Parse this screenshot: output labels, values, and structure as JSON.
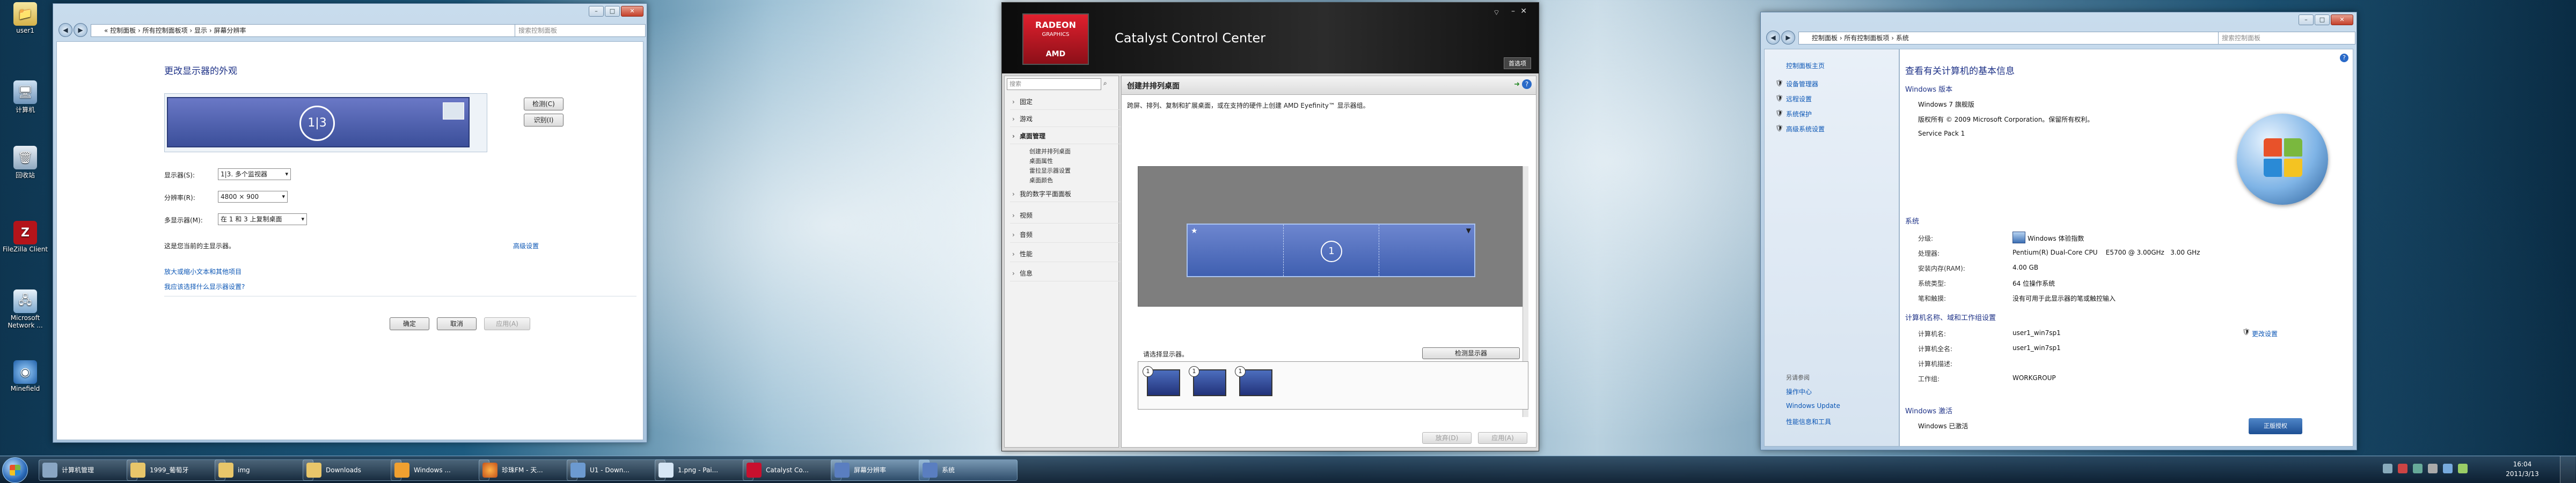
{
  "desktop": {
    "icons": [
      {
        "label": "user1"
      },
      {
        "label": "计算机"
      },
      {
        "label": "回收站"
      },
      {
        "label": "FileZilla Client"
      },
      {
        "label": "Microsoft Network ..."
      },
      {
        "label": "Minefield"
      }
    ]
  },
  "display_window": {
    "address": "« 控制面板 › 所有控制面板项 › 显示 › 屏幕分辨率",
    "search_placeholder": "搜索控制面板",
    "heading": "更改显示器的外观",
    "monitor_badge": "1|3",
    "detect_button": "检测(C)",
    "identify_button": "识别(I)",
    "display_label": "显示器(S):",
    "display_value": "1|3. 多个监视器",
    "resolution_label": "分辨率(R):",
    "resolution_value": "4800 × 900",
    "multi_label": "多显示器(M):",
    "multi_value": "在 1 和 3 上复制桌面",
    "main_display_text": "这是您当前的主显示器。",
    "advanced_link": "高级设置",
    "link_text_size": "放大或缩小文本和其他项目",
    "link_which_settings": "我应该选择什么显示器设置?",
    "ok_button": "确定",
    "cancel_button": "取消",
    "apply_button": "应用(A)"
  },
  "catalyst": {
    "title": "Catalyst Control Center",
    "logo_brand": "RADEON",
    "logo_sub": "GRAPHICS",
    "logo_maker": "AMD",
    "welcome_label": "首选项",
    "search_placeholder": "搜索",
    "page_title": "创建并排列桌面",
    "description": "跨屏、排列、复制和扩展桌面，或在支持的硬件上创建 AMD Eyefinity™ 显示器组。",
    "menu": [
      {
        "label": "固定"
      },
      {
        "label": "游戏"
      },
      {
        "label": "桌面管理"
      },
      {
        "label": "我的数字平面面板"
      },
      {
        "label": "视频"
      },
      {
        "label": "音频"
      },
      {
        "label": "性能"
      },
      {
        "label": "信息"
      }
    ],
    "submenu": [
      {
        "label": "创建并排列桌面"
      },
      {
        "label": "桌面属性"
      },
      {
        "label": "雷拉显示器设置"
      },
      {
        "label": "桌面颜色"
      }
    ],
    "desktop_badge": "1",
    "select_display_text": "请选择显示器。",
    "detect_button": "检测显示器",
    "discard_button": "放弃(D)",
    "apply_button": "应用(A)",
    "monitors": [
      {
        "label": "1"
      },
      {
        "label": "1"
      },
      {
        "label": "1"
      }
    ]
  },
  "system_window": {
    "address": "控制面板 › 所有控制面板项 › 系统",
    "search_placeholder": "搜索控制面板",
    "left_links": [
      "控制面板主页",
      "设备管理器",
      "远程设置",
      "系统保护",
      "高级系统设置"
    ],
    "see_also_title": "另请参阅",
    "see_also": [
      "操作中心",
      "Windows Update",
      "性能信息和工具"
    ],
    "heading": "查看有关计算机的基本信息",
    "edition_title": "Windows 版本",
    "edition": "Windows 7 旗舰版",
    "copyright": "版权所有 © 2009 Microsoft Corporation。保留所有权利。",
    "service_pack": "Service Pack 1",
    "system_title": "系统",
    "system_rows": [
      {
        "label": "分级:",
        "value": "Windows 体验指数"
      },
      {
        "label": "处理器:",
        "value": "Pentium(R) Dual-Core CPU    E5700 @ 3.00GHz   3.00 GHz"
      },
      {
        "label": "安装内存(RAM):",
        "value": "4.00 GB"
      },
      {
        "label": "系统类型:",
        "value": "64 位操作系统"
      },
      {
        "label": "笔和触摸:",
        "value": "没有可用于此显示器的笔或触控输入"
      }
    ],
    "computer_title": "计算机名称、域和工作组设置",
    "computer_rows": [
      {
        "label": "计算机名:",
        "value": "user1_win7sp1"
      },
      {
        "label": "计算机全名:",
        "value": "user1_win7sp1"
      },
      {
        "label": "计算机描述:",
        "value": ""
      },
      {
        "label": "工作组:",
        "value": "WORKGROUP"
      }
    ],
    "change_settings": "更改设置",
    "activation_title": "Windows 激活",
    "activation_status": "Windows 已激活",
    "genuine_badge": "正版授权"
  },
  "taskbar": {
    "items": [
      {
        "label": "计算机管理"
      },
      {
        "label": "1999_葡萄牙"
      },
      {
        "label": "img"
      },
      {
        "label": "Downloads"
      },
      {
        "label": "Windows ..."
      },
      {
        "label": "珍珠FM - 天..."
      },
      {
        "label": "U1 - Down..."
      },
      {
        "label": "1.png - Pai..."
      },
      {
        "label": "Catalyst Co..."
      },
      {
        "label": "屏幕分辨率"
      },
      {
        "label": "系统"
      }
    ],
    "clock_time": "16:04",
    "clock_date": "2011/3/13"
  },
  "colors": {
    "accent": "#3b4f9a",
    "catalyst_header": "#1a1a1a",
    "amd_red": "#c8102e"
  }
}
